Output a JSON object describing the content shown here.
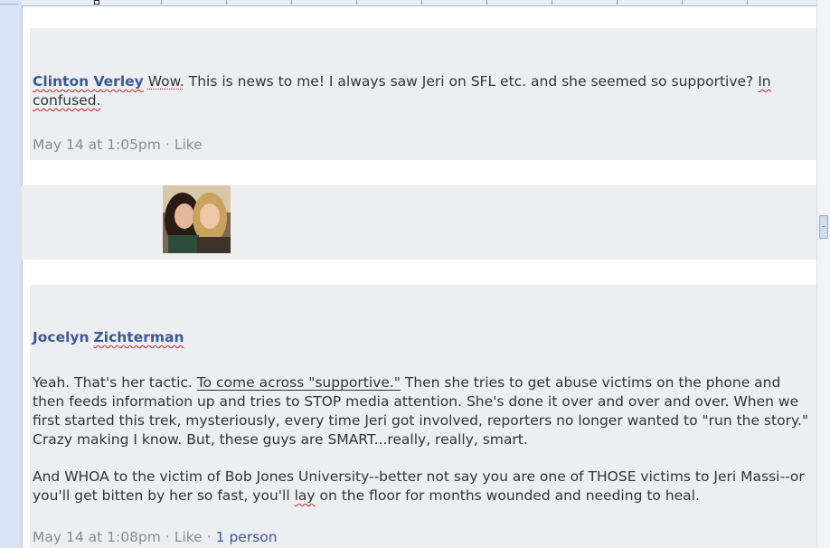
{
  "comment1": {
    "author": "Clinton Verley",
    "text_lead": "Wow.",
    "text_rest": " This is news to me! I always saw Jeri on SFL etc. and she seemed so supportive? ",
    "text_err1": "In",
    "text_err2": "confused.",
    "timestamp": "May 14 at 1:05pm",
    "separator": "·",
    "like": "Like"
  },
  "photo": {
    "alt_icon": "profile-photo-two-women"
  },
  "comment2": {
    "author_first": "Jocelyn",
    "author_last": "Zichterman",
    "p1_lead": "Yeah. That's her tactic. ",
    "p1_underlined": "To come across \"supportive.\"",
    "p1_rest": " Then she tries to get abuse victims on the phone and then feeds information up and tries to STOP media attention. She's done it over and over and over. When we first started this trek, mysteriously, every time Jeri got involved, reporters no longer wanted to \"run the story.\" Crazy making I know. But, these guys are SMART...really, really, smart.",
    "p2_lead": "And WHOA to the victim of Bob Jones University--better not say you are one of THOSE victims to Jeri Massi--or you'll get bitten by her so fast, you'll ",
    "p2_err": "lay",
    "p2_rest": " on the floor for months wounded and needing to heal.",
    "timestamp": "May 14 at 1:08pm",
    "separator": "·",
    "like": "Like",
    "separator2": "·",
    "likes_count": "1 person"
  },
  "colors": {
    "author_link": "#3b5998",
    "comment_background": "#edeef2",
    "meta_gray": "#8b8b8b",
    "spellcheck_red": "#c62828"
  }
}
